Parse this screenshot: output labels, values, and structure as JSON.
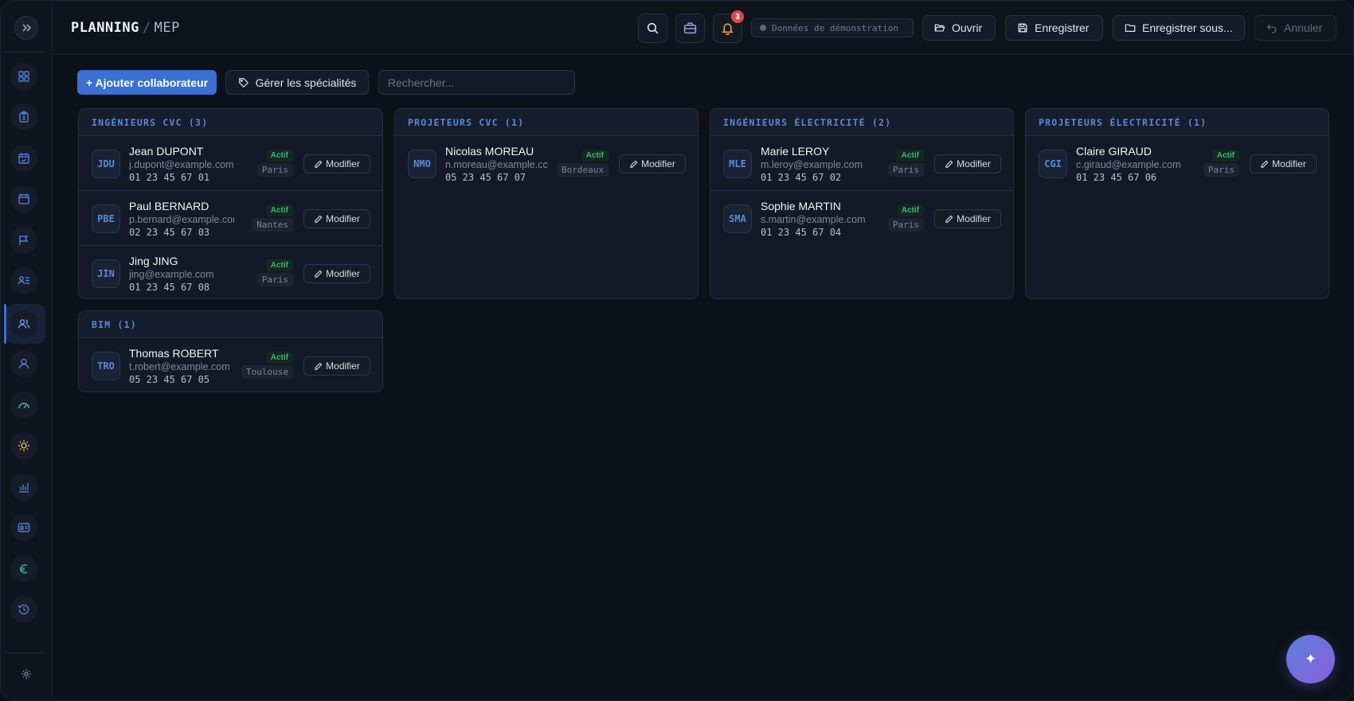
{
  "header": {
    "breadcrumb_root": "PLANNING",
    "breadcrumb_sep": "/",
    "breadcrumb_page": "MEP",
    "notification_count": "3",
    "demo_label": "Données de démonstration",
    "open_label": "Ouvrir",
    "save_label": "Enregistrer",
    "save_as_label": "Enregistrer sous...",
    "undo_label": "Annuler"
  },
  "toolbar": {
    "add_label": "+ Ajouter collaborateur",
    "specialties_label": "Gérer les spécialités",
    "search_placeholder": "Rechercher..."
  },
  "common": {
    "status_active": "Actif",
    "modify_label": "Modifier"
  },
  "groups": [
    {
      "title": "INGÉNIEURS CVC (3)",
      "people": [
        {
          "initials": "JDU",
          "name": "Jean DUPONT",
          "email": "j.dupont@example.com",
          "phone": "01 23 45 67 01",
          "city": "Paris"
        },
        {
          "initials": "PBE",
          "name": "Paul BERNARD",
          "email": "p.bernard@example.com",
          "phone": "02 23 45 67 03",
          "city": "Nantes"
        },
        {
          "initials": "JIN",
          "name": "Jing JING",
          "email": "jing@example.com",
          "phone": "01 23 45 67 08",
          "city": "Paris"
        }
      ]
    },
    {
      "title": "PROJETEURS CVC (1)",
      "people": [
        {
          "initials": "NMO",
          "name": "Nicolas MOREAU",
          "email": "n.moreau@example.cc",
          "phone": "05 23 45 67 07",
          "city": "Bordeaux"
        }
      ]
    },
    {
      "title": "INGÉNIEURS ÉLECTRICITÉ (2)",
      "people": [
        {
          "initials": "MLE",
          "name": "Marie LEROY",
          "email": "m.leroy@example.com",
          "phone": "01 23 45 67 02",
          "city": "Paris"
        },
        {
          "initials": "SMA",
          "name": "Sophie MARTIN",
          "email": "s.martin@example.com",
          "phone": "01 23 45 67 04",
          "city": "Paris"
        }
      ]
    },
    {
      "title": "PROJETEURS ÉLECTRICITÉ (1)",
      "people": [
        {
          "initials": "CGI",
          "name": "Claire GIRAUD",
          "email": "c.giraud@example.com",
          "phone": "01 23 45 67 06",
          "city": "Paris"
        }
      ]
    },
    {
      "title": "BIM (1)",
      "people": [
        {
          "initials": "TRO",
          "name": "Thomas ROBERT",
          "email": "t.robert@example.com",
          "phone": "05 23 45 67 05",
          "city": "Toulouse"
        }
      ]
    }
  ],
  "sidebar": {
    "icons": [
      "dashboard-icon",
      "clipboard-icon",
      "calendar-check-icon",
      "calendar-icon",
      "flag-icon",
      "team-list-icon",
      "users-icon",
      "user-icon",
      "gauge-icon",
      "sun-icon",
      "bar-chart-icon",
      "id-card-icon",
      "euro-icon",
      "history-icon"
    ],
    "active_index": 6
  },
  "fab_icon": "sparkle-icon",
  "colors": {
    "accent": "#3b6fd1",
    "group_title": "#5a8ad8",
    "status_green": "#3fb27f",
    "badge_red": "#d94b4b"
  }
}
